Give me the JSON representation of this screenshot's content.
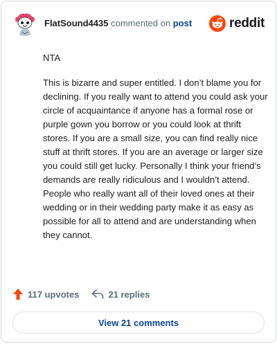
{
  "header": {
    "username": "FlatSound4435",
    "action_text": "commented on",
    "post_link": "post",
    "brand_name": "reddit"
  },
  "comment": {
    "paragraphs": [
      "NTA",
      "This is bizarre and super entitled. I don’t blame you for declining. If you really want to attend you could ask your circle of acquaintance if anyone has a formal rose or purple gown you borrow or you could look at thrift stores. If you are a small size, you can find really nice stuff at thrift stores. If you are an average or larger size you could still get lucky. Personally I think your friend’s demands are really ridiculous and I wouldn’t attend. People who really want all of their loved ones at their wedding or in their wedding party make it as easy as possible for all to attend and are understanding when they cannot."
    ]
  },
  "actions": {
    "upvotes_label": "117 upvotes",
    "replies_label": "21 replies"
  },
  "footer": {
    "view_comments_label": "View 21 comments"
  },
  "colors": {
    "brand_orange": "#ff4500",
    "avatar_pink": "#e2466f",
    "text_primary": "#1c1c1c",
    "text_secondary": "#576f76",
    "link_blue": "#0a449b",
    "border": "#d4d8dd"
  },
  "icons": {
    "avatar": "snoo-avatar",
    "brand": "reddit-logo-icon",
    "upvote": "upvote-arrow-icon",
    "reply": "reply-arrow-icon"
  }
}
